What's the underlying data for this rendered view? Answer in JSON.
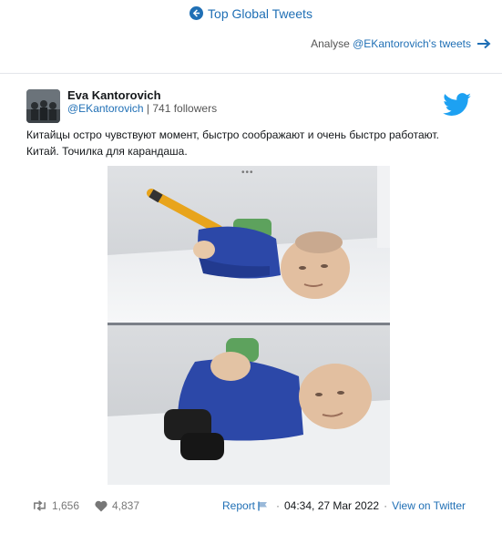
{
  "topnav": {
    "label": "Top Global Tweets"
  },
  "analyse": {
    "prefix": "Analyse ",
    "handle": "@EKantorovich's tweets"
  },
  "tweet": {
    "author_name": "Eva Kantorovich",
    "handle": "@EKantorovich",
    "meta_sep": " | ",
    "followers": "741 followers",
    "text_line1": "Китайцы остро чувствуют момент, быстро соображают и очень быстро работают.",
    "text_line2": "Китай. Точилка для карандаша.",
    "media_more": "•••",
    "retweets": "1,656",
    "likes": "4,837",
    "report": "Report",
    "sep": "·",
    "timestamp": "04:34, 27 Mar 2022",
    "view_link": "View on Twitter"
  },
  "colors": {
    "link": "#1f6fb5",
    "twitter_blue": "#1da1f2"
  },
  "icons": [
    "arrow-left-circle-icon",
    "arrow-right-icon",
    "twitter-bird-icon",
    "retweet-icon",
    "heart-icon",
    "flag-icon"
  ]
}
